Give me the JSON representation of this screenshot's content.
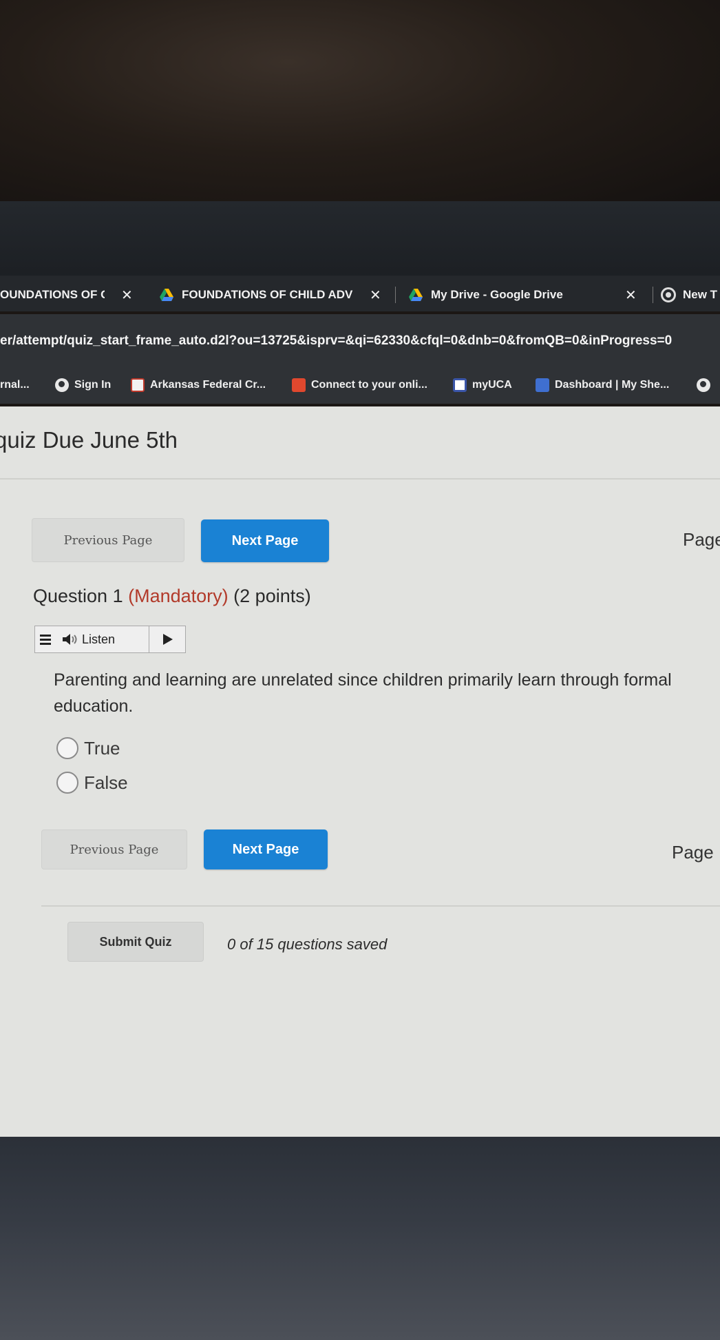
{
  "browser": {
    "tabs": [
      {
        "label": "OUNDATIONS OF CH",
        "active": true
      },
      {
        "label": "FOUNDATIONS OF CHILD ADV",
        "active": false
      },
      {
        "label": "My Drive - Google Drive",
        "active": false
      },
      {
        "label": "New T",
        "active": false
      }
    ],
    "url": "er/attempt/quiz_start_frame_auto.d2l?ou=13725&isprv=&qi=62330&cfql=0&dnb=0&fromQB=0&inProgress=0",
    "bookmarks": [
      {
        "label": "rnal...",
        "icon": "none"
      },
      {
        "label": "Sign In",
        "icon": "globe-icon"
      },
      {
        "label": "Arkansas Federal Cr...",
        "icon": "bank-icon"
      },
      {
        "label": "Connect to your onli...",
        "icon": "shield-icon"
      },
      {
        "label": "myUCA",
        "icon": "uca-icon"
      },
      {
        "label": "Dashboard | My She...",
        "icon": "dashboard-icon"
      }
    ]
  },
  "quiz": {
    "title": "quiz Due June 5th",
    "nav_top": {
      "previous": "Previous Page",
      "next": "Next Page",
      "page": "Page"
    },
    "question": {
      "label": "Question 1",
      "mandatory": "(Mandatory)",
      "points": "(2 points)",
      "text": "Parenting and learning are unrelated since children primarily learn through formal education.",
      "options": [
        "True",
        "False"
      ]
    },
    "listen": {
      "label": "Listen"
    },
    "nav_bottom": {
      "previous": "Previous Page",
      "next": "Next Page",
      "page": "Page"
    },
    "submit": "Submit Quiz",
    "save_status": "0 of 15 questions saved"
  },
  "colors": {
    "next_button": "#1a82d4",
    "mandatory": "#b23a2a",
    "page_bg": "#e2e3e0"
  }
}
